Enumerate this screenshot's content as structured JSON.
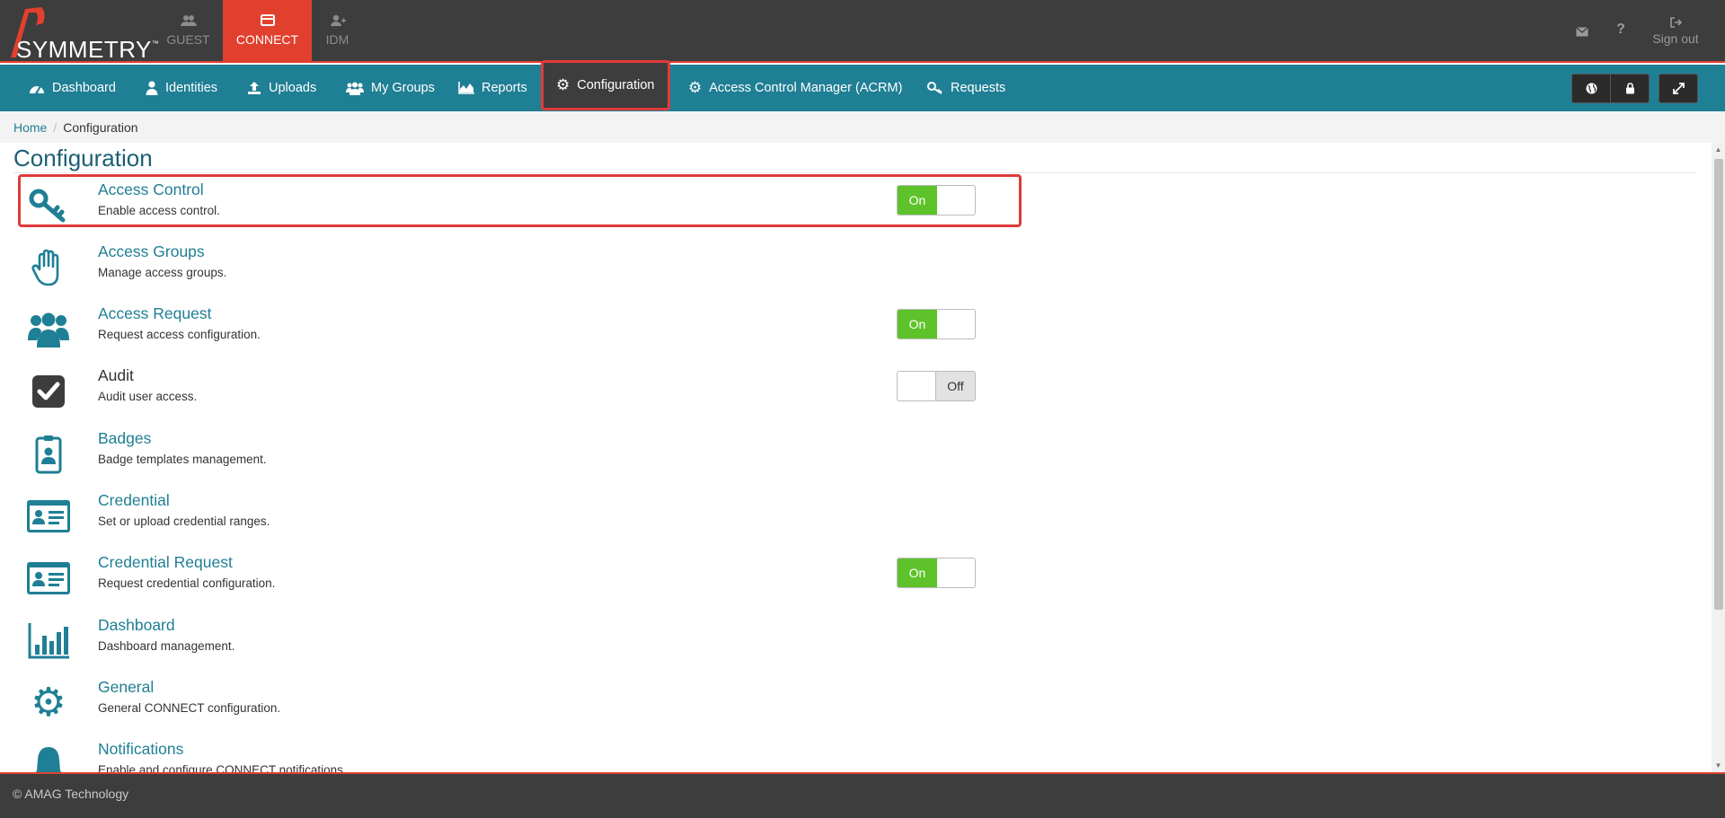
{
  "app": {
    "logo_text": "SYMMETRY",
    "logo_tm": "™",
    "brand_color": "#e2402e",
    "nav_color": "#1f7f94"
  },
  "topbar": {
    "products": [
      {
        "label": "GUEST",
        "icon": "users-icon",
        "active": false
      },
      {
        "label": "CONNECT",
        "icon": "card-icon",
        "active": true
      },
      {
        "label": "IDM",
        "icon": "add-user-icon",
        "active": false
      }
    ],
    "signout_label": "Sign out"
  },
  "nav": {
    "items": [
      {
        "label": "Dashboard",
        "icon": "dashboard-icon"
      },
      {
        "label": "Identities",
        "icon": "user-icon"
      },
      {
        "label": "Uploads",
        "icon": "upload-icon"
      },
      {
        "label": "My Groups",
        "icon": "group-icon"
      },
      {
        "label": "Reports",
        "icon": "area-chart-icon"
      },
      {
        "label": "Configuration",
        "icon": "gear-icon",
        "active": true
      },
      {
        "label": "Access Control Manager (ACRM)",
        "icon": "gear-icon"
      },
      {
        "label": "Requests",
        "icon": "key-icon"
      }
    ]
  },
  "breadcrumb": {
    "home": "Home",
    "separator": "/",
    "current": "Configuration"
  },
  "page": {
    "title": "Configuration"
  },
  "config_items": [
    {
      "name": "Access Control",
      "desc": "Enable access control.",
      "icon": "key-icon",
      "toggle": "On"
    },
    {
      "name": "Access Groups",
      "desc": "Manage access groups.",
      "icon": "hand-icon",
      "toggle": null
    },
    {
      "name": "Access Request",
      "desc": "Request access configuration.",
      "icon": "people-icon",
      "toggle": "On"
    },
    {
      "name": "Audit",
      "desc": "Audit user access.",
      "icon": "checkbox-icon",
      "toggle": "Off"
    },
    {
      "name": "Badges",
      "desc": "Badge templates management.",
      "icon": "badge-icon",
      "toggle": null
    },
    {
      "name": "Credential",
      "desc": "Set or upload credential ranges.",
      "icon": "id-card-icon",
      "toggle": null
    },
    {
      "name": "Credential Request",
      "desc": "Request credential configuration.",
      "icon": "id-card-icon",
      "toggle": "On"
    },
    {
      "name": "Dashboard",
      "desc": "Dashboard management.",
      "icon": "bar-chart-icon",
      "toggle": null
    },
    {
      "name": "General",
      "desc": "General CONNECT configuration.",
      "icon": "gear-icon",
      "toggle": null
    },
    {
      "name": "Notifications",
      "desc": "Enable and configure CONNECT notifications.",
      "icon": "bell-icon",
      "toggle": null
    }
  ],
  "toggle_labels": {
    "on": "On",
    "off": "Off"
  },
  "footer": {
    "text": "© AMAG Technology"
  }
}
